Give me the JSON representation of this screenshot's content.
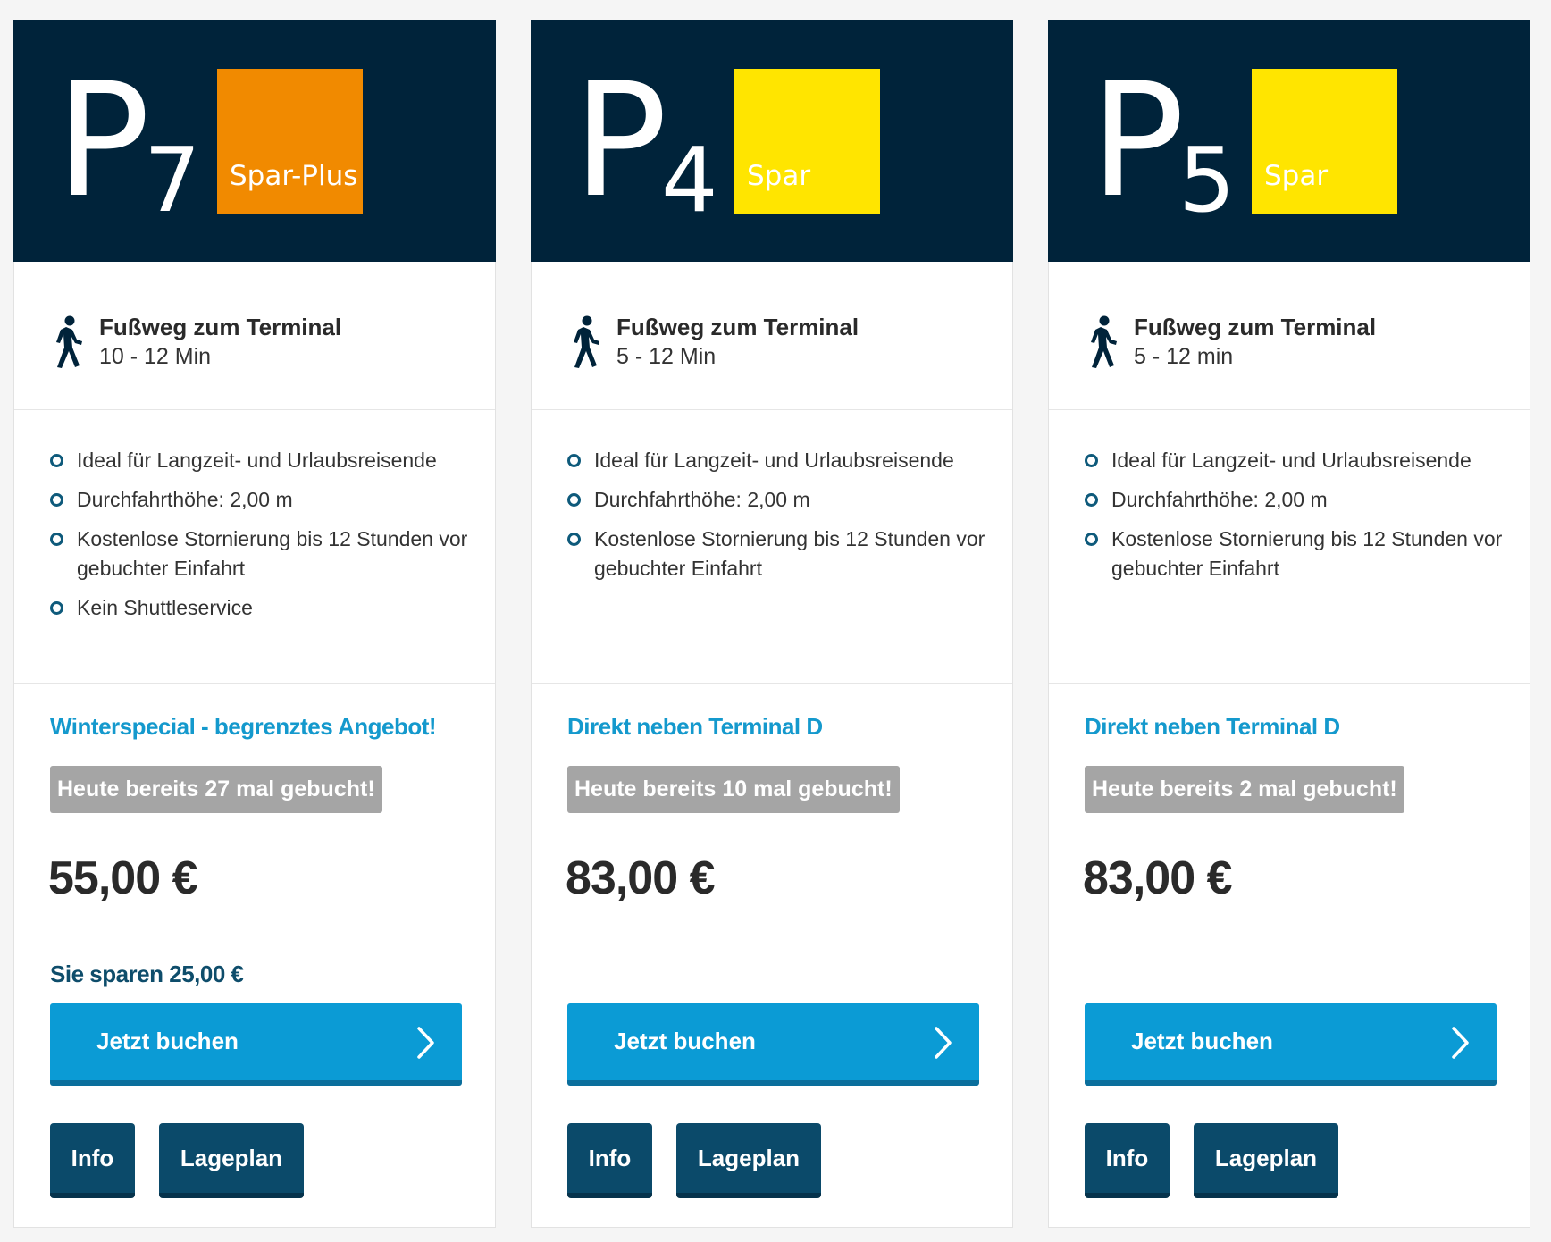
{
  "cards": [
    {
      "logo_letter": "P",
      "logo_number": "7",
      "tariff_label": "Spar-Plus",
      "tariff_color": "#f18a00",
      "walk_title": "Fußweg zum Terminal",
      "walk_time": "10 - 12 Min",
      "features": [
        "Ideal für Langzeit- und Urlaubsreisende",
        "Durchfahrthöhe: 2,00 m",
        "Kostenlose Stornierung bis 12 Stunden vor gebuchter Einfahrt",
        "Kein Shuttleservice"
      ],
      "promo": "Winterspecial - begrenztes Angebot!",
      "booked": "Heute bereits 27 mal gebucht!",
      "price": "55,00 €",
      "savings": "Sie sparen 25,00 €",
      "book_label": "Jetzt buchen",
      "info_label": "Info",
      "plan_label": "Lageplan"
    },
    {
      "logo_letter": "P",
      "logo_number": "4",
      "tariff_label": "Spar",
      "tariff_color": "#ffe500",
      "walk_title": "Fußweg zum Terminal",
      "walk_time": "5 - 12 Min",
      "features": [
        "Ideal für Langzeit- und Urlaubsreisende",
        "Durchfahrthöhe: 2,00 m",
        "Kostenlose Stornierung bis 12 Stunden vor gebuchter Einfahrt"
      ],
      "promo": "Direkt neben Terminal D",
      "booked": "Heute bereits 10 mal gebucht!",
      "price": "83,00 €",
      "savings": "",
      "book_label": "Jetzt buchen",
      "info_label": "Info",
      "plan_label": "Lageplan"
    },
    {
      "logo_letter": "P",
      "logo_number": "5",
      "tariff_label": "Spar",
      "tariff_color": "#ffe500",
      "walk_title": "Fußweg zum Terminal",
      "walk_time": "5 - 12 min",
      "features": [
        "Ideal für Langzeit- und Urlaubsreisende",
        "Durchfahrthöhe: 2,00 m",
        "Kostenlose Stornierung bis 12 Stunden vor gebuchter Einfahrt"
      ],
      "promo": "Direkt neben Terminal D",
      "booked": "Heute bereits 2 mal gebucht!",
      "price": "83,00 €",
      "savings": "",
      "book_label": "Jetzt buchen",
      "info_label": "Info",
      "plan_label": "Lageplan"
    }
  ]
}
